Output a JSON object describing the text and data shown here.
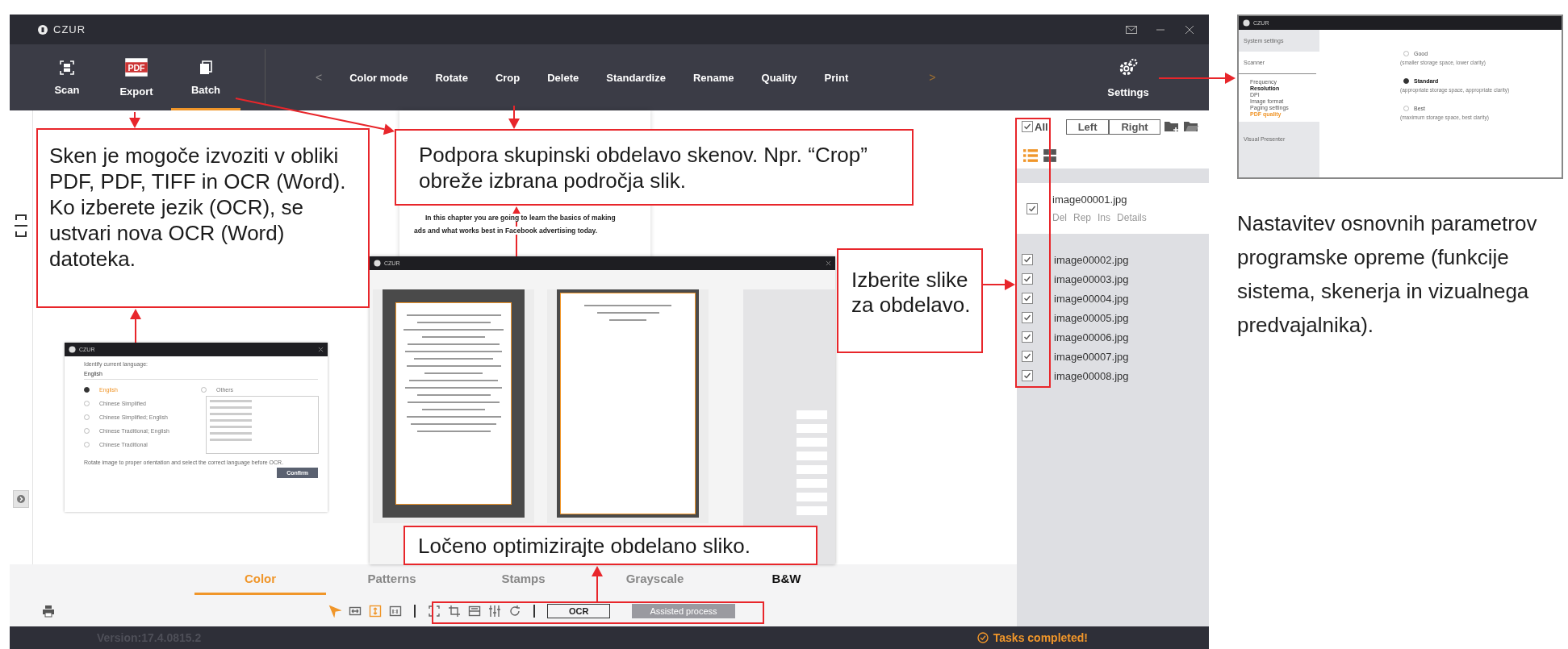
{
  "window": {
    "title": "CZUR"
  },
  "toolbar": {
    "main_buttons": [
      {
        "kind": "scan",
        "label": "Scan",
        "selected": false
      },
      {
        "kind": "export",
        "label": "Export",
        "icon_text": "PDF",
        "selected": false
      },
      {
        "kind": "batch",
        "label": "Batch",
        "selected": true
      }
    ],
    "prev": "<",
    "actions": [
      "Color mode",
      "Rotate",
      "Crop",
      "Delete",
      "Standardize",
      "Rename",
      "Quality",
      "Print"
    ],
    "next": ">",
    "settings": "Settings"
  },
  "document": {
    "lines": [
      "In this chapter you are going to learn the basics of making",
      "ads and what works best in Facebook advertising today."
    ]
  },
  "language_dialog": {
    "title": "CZUR",
    "prompt": "Identify current language:",
    "value": "English",
    "languages": [
      {
        "label": "English",
        "selected": true
      },
      {
        "label": "Chinese Simplified",
        "selected": false
      },
      {
        "label": "Chinese Simplified; English",
        "selected": false
      },
      {
        "label": "Chinese Traditional; English",
        "selected": false
      },
      {
        "label": "Chinese Traditional",
        "selected": false
      }
    ],
    "others": {
      "label": "Others",
      "selected": false
    },
    "note": "Rotate image to proper orientation and select the correct language before OCR.",
    "button": "Confirm"
  },
  "crop_dialog": {
    "title": "CZUR"
  },
  "file_panel": {
    "all": {
      "label": "All",
      "checked": true
    },
    "sides": [
      "Left",
      "Right"
    ],
    "views": [
      {
        "kind": "list",
        "selected": true
      },
      {
        "kind": "grid",
        "selected": false
      }
    ],
    "files": [
      {
        "name": "image00001.jpg",
        "checked": true,
        "expanded": true,
        "actions": [
          "Del",
          "Rep",
          "Ins",
          "Details"
        ]
      },
      {
        "name": "image00002.jpg",
        "checked": true,
        "expanded": false
      },
      {
        "name": "image00003.jpg",
        "checked": true,
        "expanded": false
      },
      {
        "name": "image00004.jpg",
        "checked": true,
        "expanded": false
      },
      {
        "name": "image00005.jpg",
        "checked": true,
        "expanded": false
      },
      {
        "name": "image00006.jpg",
        "checked": true,
        "expanded": false
      },
      {
        "name": "image00007.jpg",
        "checked": true,
        "expanded": false
      },
      {
        "name": "image00008.jpg",
        "checked": true,
        "expanded": false
      }
    ]
  },
  "mode_tabs": [
    {
      "label": "Color",
      "selected": true,
      "hovered": false
    },
    {
      "label": "Patterns",
      "selected": false,
      "hovered": false
    },
    {
      "label": "Stamps",
      "selected": false,
      "hovered": false
    },
    {
      "label": "Grayscale",
      "selected": false,
      "hovered": false
    },
    {
      "label": "B&W",
      "selected": false,
      "hovered": true
    }
  ],
  "tools": {
    "view_tools": [
      {
        "kind": "pointer",
        "active": true
      },
      {
        "kind": "fit-width",
        "active": false
      },
      {
        "kind": "fit-height",
        "active": true
      },
      {
        "kind": "actual-size",
        "active": false
      }
    ],
    "edit_tools": [
      {
        "kind": "select",
        "active": false
      },
      {
        "kind": "crop",
        "active": false
      },
      {
        "kind": "straighten",
        "active": false
      },
      {
        "kind": "adjust",
        "active": false
      },
      {
        "kind": "rotate",
        "active": false
      }
    ],
    "ocr": "OCR",
    "assisted": {
      "label": "Assisted process",
      "disabled": true
    }
  },
  "status_bar": {
    "version": "Version:17.4.0815.2",
    "message": "Tasks completed!"
  },
  "callouts": [
    {
      "text": "Sken je mogoče izvoziti v obliki PDF, PDF, TIFF in OCR (Word). Ko izberete jezik (OCR), se ustvari nova OCR (Word) datoteka."
    },
    {
      "text": "Podpora skupinski obdelavo skenov. Npr. “Crop” obreže izbrana področja slik."
    },
    {
      "text": "Izberite slike za obdelavo."
    },
    {
      "text": "Ločeno optimizirajte obdelano sliko."
    }
  ],
  "settings_dialog": {
    "title": "CZUR",
    "sections": [
      {
        "label": "System settings",
        "expanded": false
      },
      {
        "label": "Scanner",
        "expanded": true,
        "items": [
          {
            "label": "Frequency",
            "selected": false,
            "hovered": false
          },
          {
            "label": "Resolution",
            "selected": false,
            "hovered": true
          },
          {
            "label": "DPI",
            "selected": false,
            "hovered": false
          },
          {
            "label": "Image format",
            "selected": false,
            "hovered": false
          },
          {
            "label": "Paging settings",
            "selected": false,
            "hovered": false
          },
          {
            "label": "PDF quality",
            "selected": true,
            "hovered": false
          }
        ]
      },
      {
        "label": "Visual Presenter",
        "expanded": false
      }
    ],
    "options": [
      {
        "label": "Good",
        "note": "(smaller storage space, lower clarity)",
        "selected": false
      },
      {
        "label": "Standard",
        "note": "(appropriate storage space, appropriate clarity)",
        "selected": true
      },
      {
        "label": "Best",
        "note": "(maximum storage space, best clarity)",
        "selected": false
      }
    ]
  },
  "description": "Nastavitev osnovnih parametrov programske opreme (funkcije sistema, skenerja in vizualnega predvajalnika)."
}
